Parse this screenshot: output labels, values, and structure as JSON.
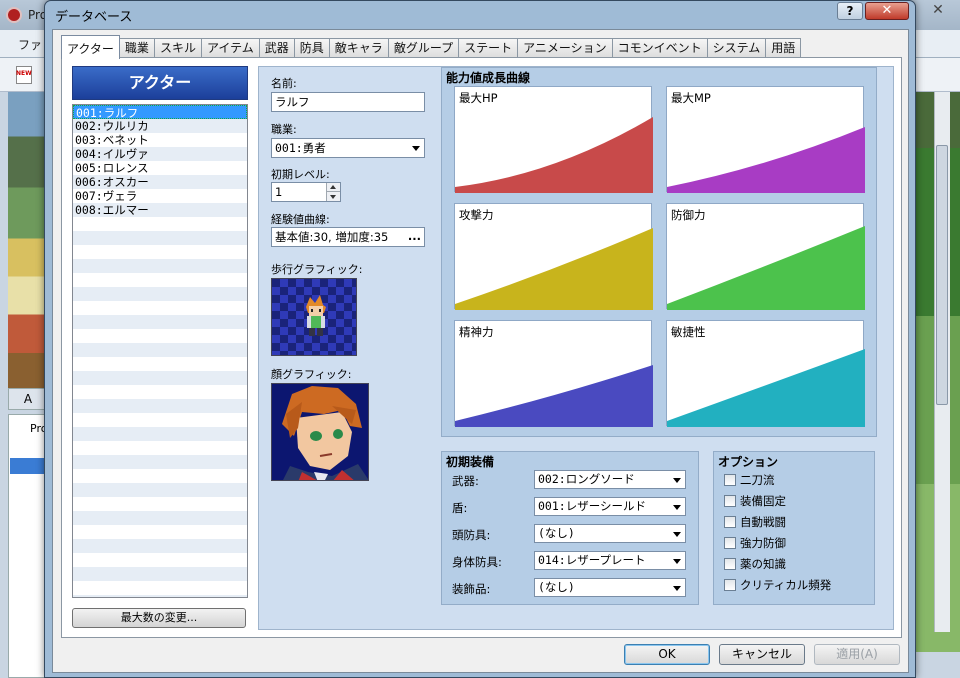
{
  "background_app": {
    "title": "Pro",
    "menu_first": "ファ",
    "tile_tab": "A",
    "tree_root": "Pro",
    "close_glyph": "✕"
  },
  "window": {
    "title": "データベース",
    "help_label": "?",
    "close_label": "✕"
  },
  "tabs": [
    "アクター",
    "職業",
    "スキル",
    "アイテム",
    "武器",
    "防具",
    "敵キャラ",
    "敵グループ",
    "ステート",
    "アニメーション",
    "コモンイベント",
    "システム",
    "用語"
  ],
  "actor_panel": {
    "header": "アクター",
    "actors": [
      "001:ラルフ",
      "002:ウルリカ",
      "003:ベネット",
      "004:イルヴァ",
      "005:ロレンス",
      "006:オスカー",
      "007:ヴェラ",
      "008:エルマー"
    ],
    "selected_index": 0,
    "max_button": "最大数の変更..."
  },
  "fields": {
    "name_label": "名前:",
    "name_value": "ラルフ",
    "class_label": "職業:",
    "class_value": "001:勇者",
    "level_label": "初期レベル:",
    "level_value": "1",
    "exp_label": "経験値曲線:",
    "exp_value": "基本値:30, 増加度:35",
    "exp_button": "...",
    "walk_label": "歩行グラフィック:",
    "face_label": "顔グラフィック:"
  },
  "graphs": {
    "title": "能力値成長曲線",
    "items": [
      {
        "label": "最大HP",
        "color": "#c84a4a"
      },
      {
        "label": "最大MP",
        "color": "#a83cc4"
      },
      {
        "label": "攻撃力",
        "color": "#c8b41c"
      },
      {
        "label": "防御力",
        "color": "#4cc24c"
      },
      {
        "label": "精神力",
        "color": "#4a4ac0"
      },
      {
        "label": "敏捷性",
        "color": "#22b0c0"
      }
    ]
  },
  "equipment": {
    "title": "初期装備",
    "slots": [
      {
        "label": "武器:",
        "value": "002:ロングソード"
      },
      {
        "label": "盾:",
        "value": "001:レザーシールド"
      },
      {
        "label": "頭防具:",
        "value": "(なし)"
      },
      {
        "label": "身体防具:",
        "value": "014:レザープレート"
      },
      {
        "label": "装飾品:",
        "value": "(なし)"
      }
    ]
  },
  "options": {
    "title": "オプション",
    "items": [
      "二刀流",
      "装備固定",
      "自動戦闘",
      "強力防御",
      "薬の知識",
      "クリティカル頻発"
    ]
  },
  "buttons": {
    "ok": "OK",
    "cancel": "キャンセル",
    "apply": "適用(A)"
  }
}
